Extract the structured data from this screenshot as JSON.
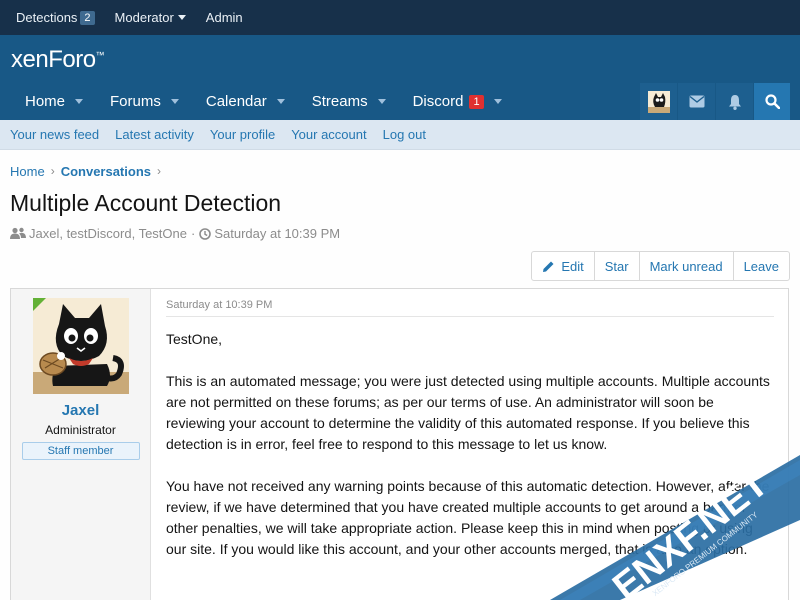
{
  "staff_bar": {
    "detections_label": "Detections",
    "detections_count": "2",
    "moderator_label": "Moderator",
    "admin_label": "Admin"
  },
  "logo": {
    "text": "xenForo",
    "mark": "™"
  },
  "nav": {
    "tabs": [
      {
        "label": "Home"
      },
      {
        "label": "Forums"
      },
      {
        "label": "Calendar"
      },
      {
        "label": "Streams"
      },
      {
        "label": "Discord",
        "badge": "1"
      }
    ],
    "icons": [
      "avatar",
      "envelope-icon",
      "bell-icon",
      "search-icon"
    ]
  },
  "subnav": {
    "items": [
      {
        "label": "Your news feed"
      },
      {
        "label": "Latest activity"
      },
      {
        "label": "Your profile"
      },
      {
        "label": "Your account"
      },
      {
        "label": "Log out"
      }
    ]
  },
  "breadcrumb": {
    "home": "Home",
    "current": "Conversations"
  },
  "page": {
    "title": "Multiple Account Detection",
    "participants": "Jaxel, testDiscord, TestOne",
    "date": "Saturday at 10:39 PM"
  },
  "actions": {
    "edit": "Edit",
    "star": "Star",
    "mark_unread": "Mark unread",
    "leave": "Leave"
  },
  "message": {
    "user": {
      "name": "Jaxel",
      "title": "Administrator",
      "badge": "Staff member"
    },
    "date": "Saturday at 10:39 PM",
    "greeting": "TestOne,",
    "paragraph1": "This is an automated message; you were just detected using multiple accounts. Multiple accounts are not permitted on these forums; as per our terms of use. An administrator will soon be reviewing your account to determine the validity of this automated response. If you believe this detection is in error, feel free to respond to this message to let us know.",
    "paragraph2": "You have not received any warning points because of this automatic detection. However, after the review, if we have determined that you have created multiple accounts to get around a ban, or other penalties, we will take appropriate action. Please keep this in mind when posting or using our site. If you would like this account, and your other accounts merged, that is also an option."
  },
  "watermark": {
    "brand": "ENXF.NET",
    "tagline": "XENFORO PREMIUM COMMUNITY"
  },
  "colors": {
    "staff_bar": "#17304a",
    "header": "#185886",
    "subnav": "#dce7f2",
    "link": "#2577b1",
    "badge_red": "#e03030",
    "online": "#63b136"
  }
}
